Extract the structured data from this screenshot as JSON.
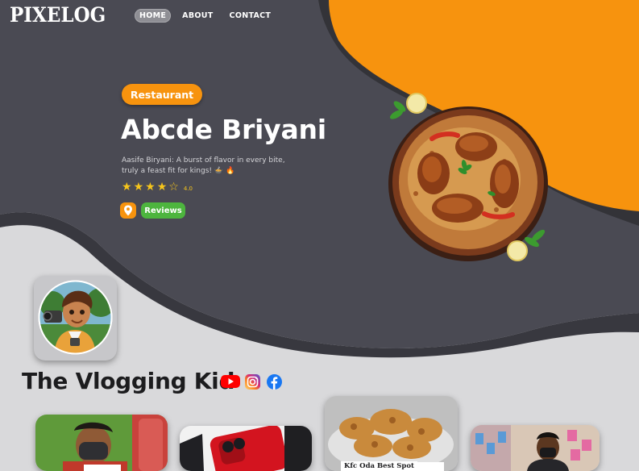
{
  "header": {
    "logo": "PIXELOG",
    "nav": [
      "HOME",
      "ABOUT",
      "CONTACT"
    ],
    "active": "HOME"
  },
  "hero": {
    "tag": "Restaurant",
    "title": "Abcde Briyani",
    "description": "Aasife Biryani: A burst of flavor in every bite, truly a feast fit for kings! 🍲 🔥",
    "rating": 4.0,
    "rating_label": "4.0",
    "reviews_button": "Reviews"
  },
  "profile": {
    "name": "The Vlogging Kid",
    "social": [
      "youtube-icon",
      "instagram-icon",
      "facebook-icon"
    ]
  },
  "videos": [
    {
      "caption": ""
    },
    {
      "caption": ""
    },
    {
      "caption": "Kfc Oda Best Spot"
    },
    {
      "caption": ""
    }
  ],
  "colors": {
    "dark": "#4a4a53",
    "orange": "#f7930e",
    "light": "#d9d9db",
    "green": "#4db53e",
    "star": "#f6c51b"
  }
}
